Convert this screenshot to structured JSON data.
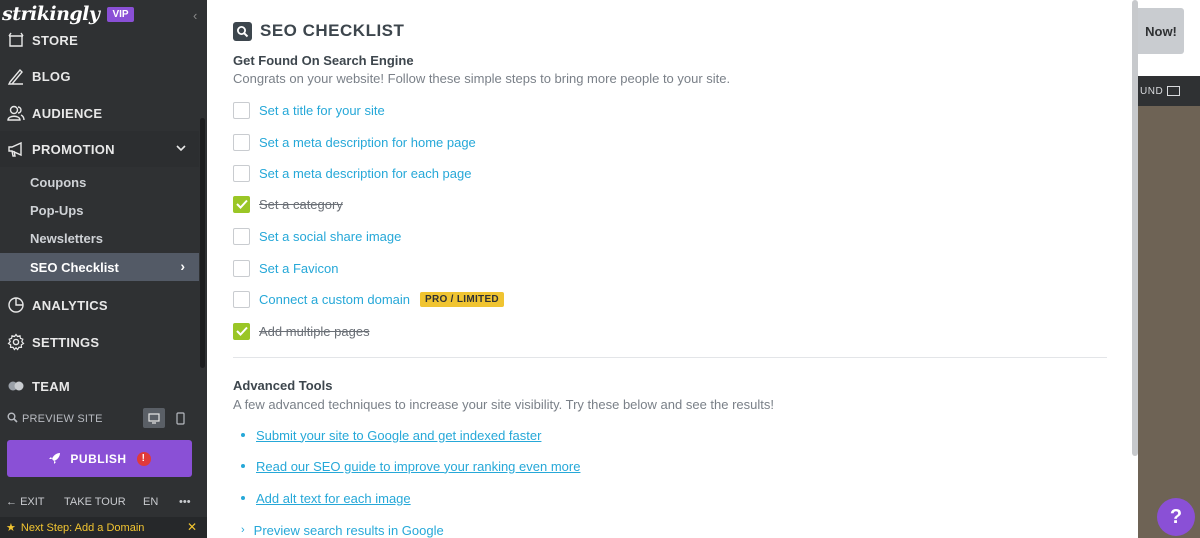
{
  "brand": {
    "logo_text": "strikingly",
    "vip_badge": "VIP"
  },
  "sidebar": {
    "items": [
      {
        "label": "STORE",
        "icon": "store-icon"
      },
      {
        "label": "BLOG",
        "icon": "blog-icon"
      },
      {
        "label": "AUDIENCE",
        "icon": "audience-icon"
      },
      {
        "label": "PROMOTION",
        "icon": "megaphone-icon",
        "expanded": true
      },
      {
        "label": "ANALYTICS",
        "icon": "analytics-icon"
      },
      {
        "label": "SETTINGS",
        "icon": "gear-icon"
      },
      {
        "label": "TEAM",
        "icon": "team-icon"
      }
    ],
    "promotion_subitems": [
      "Coupons",
      "Pop-Ups",
      "Newsletters",
      "SEO Checklist"
    ],
    "selected_subitem": "SEO Checklist",
    "preview_label": "PREVIEW SITE",
    "publish_label": "PUBLISH",
    "publish_alert": "!",
    "bottom": {
      "exit": "EXIT",
      "tour": "TAKE TOUR",
      "lang": "EN",
      "more": "•••"
    },
    "next_step": "Next Step: Add a Domain"
  },
  "main": {
    "title": "SEO CHECKLIST",
    "section1": {
      "title": "Get Found On Search Engine",
      "desc": "Congrats on your website! Follow these simple steps to bring more people to your site.",
      "items": [
        {
          "label": "Set a title for your site",
          "checked": false
        },
        {
          "label": "Set a meta description for home page",
          "checked": false
        },
        {
          "label": "Set a meta description for each page",
          "checked": false
        },
        {
          "label": "Set a category",
          "checked": true
        },
        {
          "label": "Set a social share image",
          "checked": false
        },
        {
          "label": "Set a Favicon",
          "checked": false
        },
        {
          "label": "Connect a custom domain",
          "checked": false,
          "tag": "PRO / LIMITED"
        },
        {
          "label": "Add multiple pages",
          "checked": true
        }
      ]
    },
    "section2": {
      "title": "Advanced Tools",
      "desc": "A few advanced techniques to increase your site visibility. Try these below and see the results!",
      "links": [
        "Submit your site to Google and get indexed faster",
        "Read our SEO guide to improve your ranking even more",
        "Add alt text for each image",
        "Preview search results in Google"
      ]
    }
  },
  "editor": {
    "now_label": "Now!",
    "bg_label": "UND",
    "help_label": "?"
  },
  "colors": {
    "accent": "#8a50d6",
    "link": "#26a8d8",
    "check": "#9ac626",
    "tag": "#f0c431",
    "sidebar": "#2f3133"
  }
}
